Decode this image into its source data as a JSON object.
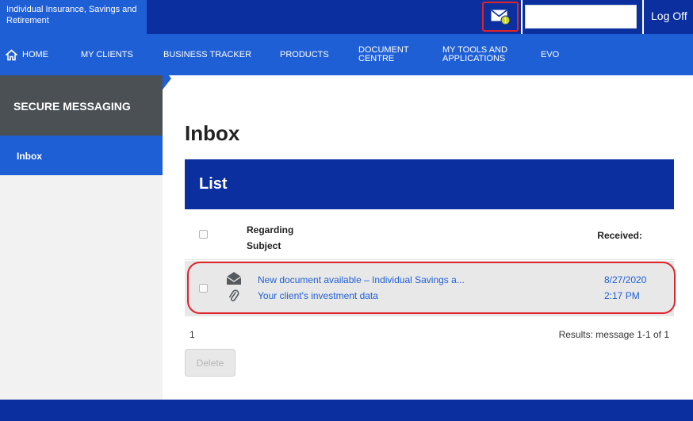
{
  "header": {
    "brand": "Individual Insurance, Savings and Retirement",
    "mail_badge": "1",
    "search_value": "",
    "logoff_label": "Log Off"
  },
  "nav": {
    "home": "HOME",
    "my_clients": "MY CLIENTS",
    "business_tracker": "BUSINESS TRACKER",
    "products": "PRODUCTS",
    "document_centre_l1": "DOCUMENT",
    "document_centre_l2": "CENTRE",
    "my_tools_l1": "MY TOOLS AND",
    "my_tools_l2": "APPLICATIONS",
    "evo": "EVO"
  },
  "sidebar": {
    "title": "SECURE MESSAGING",
    "items": [
      {
        "label": "Inbox",
        "active": true
      }
    ]
  },
  "main": {
    "page_title": "Inbox",
    "list_title": "List",
    "columns": {
      "regarding": "Regarding",
      "subject": "Subject",
      "received": "Received:"
    },
    "messages": [
      {
        "regarding": "New document available – Individual Savings a...",
        "subject": "Your client's investment data",
        "date": "8/27/2020",
        "time": "2:17 PM",
        "has_attachment": true,
        "read": true
      }
    ],
    "pager": "1",
    "results": "Results: message 1-1 of 1",
    "delete_label": "Delete"
  },
  "colors": {
    "dark_blue": "#0b2f9e",
    "nav_blue": "#1f5fd6",
    "sidebar_header": "#4a5054",
    "highlight_red": "#e0242b",
    "badge_yellow": "#c8d22a"
  }
}
